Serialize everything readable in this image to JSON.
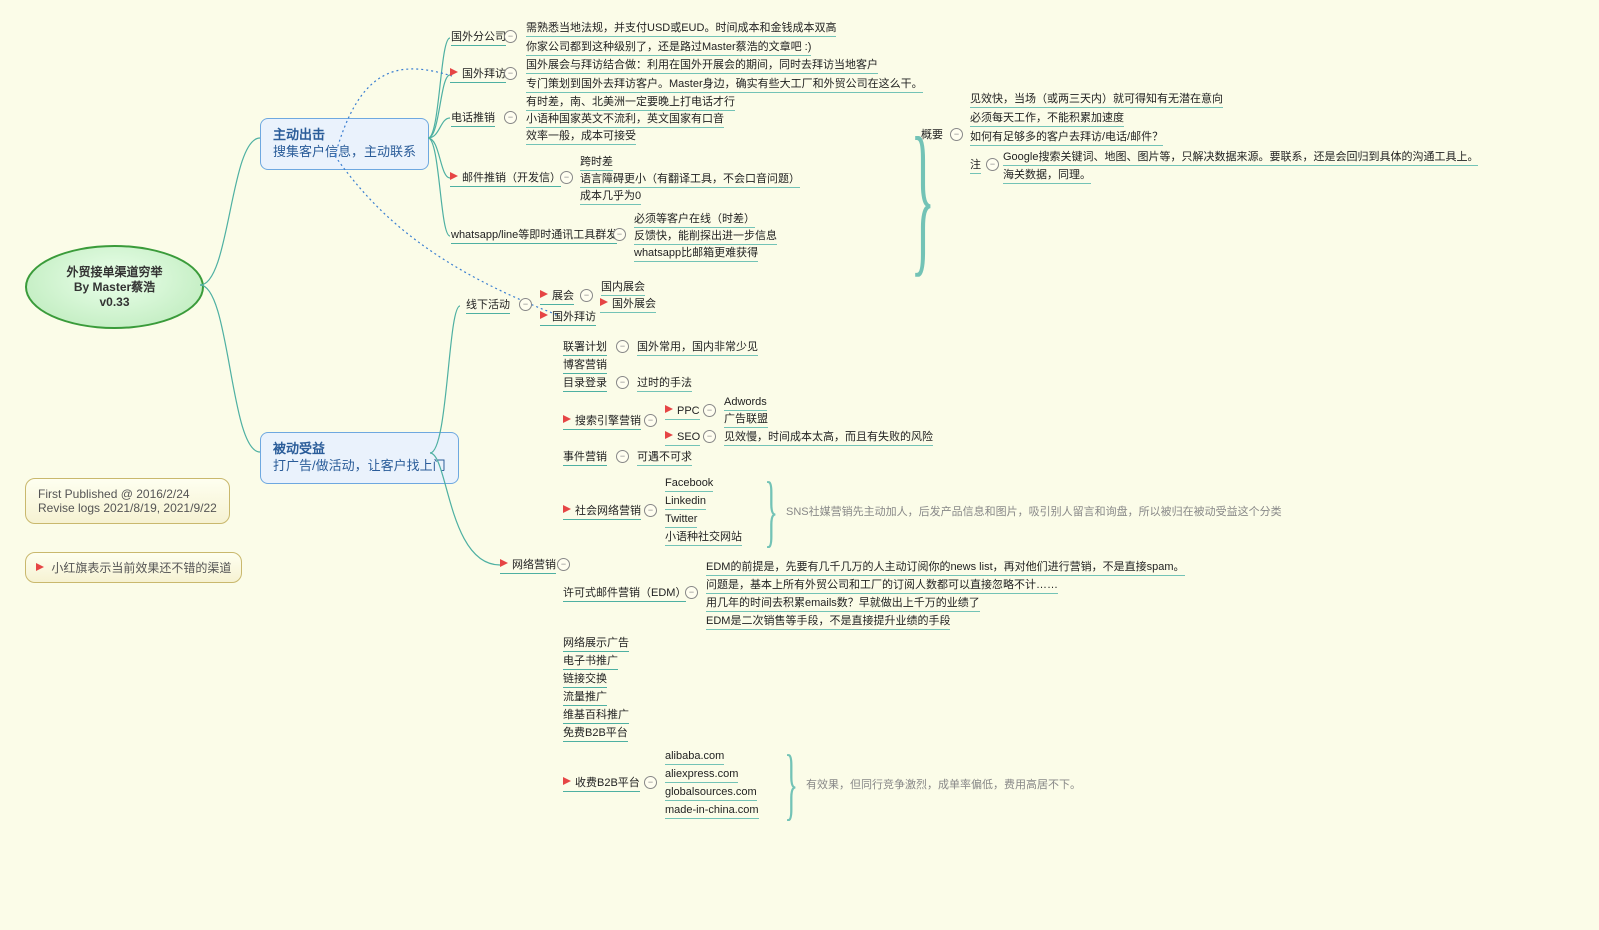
{
  "root": {
    "line1": "外贸接单渠道穷举",
    "line2": "By Master蔡浩",
    "line3": "v0.33"
  },
  "info": {
    "l1": "First Published @ 2016/2/24",
    "l2": "Revise logs 2021/8/19, 2021/9/22"
  },
  "legend": "小红旗表示当前效果还不错的渠道",
  "branch1": {
    "title": "主动出击",
    "sub": "搜集客户信息，主动联系"
  },
  "branch2": {
    "title": "被动受益",
    "sub": "打广告/做活动，让客户找上门"
  },
  "b1": {
    "c1": "国外分公司",
    "c1a": "需熟悉当地法规，并支付USD或EUD。时间成本和金钱成本双高",
    "c1b": "你家公司都到这种级别了，还是路过Master蔡浩的文章吧 :)",
    "c2": "国外拜访",
    "c2a": "国外展会与拜访结合做：利用在国外开展会的期间，同时去拜访当地客户",
    "c2b": "专门策划到国外去拜访客户。Master身边，确实有些大工厂和外贸公司在这么干。",
    "c3": "电话推销",
    "c3a": "有时差，南、北美洲一定要晚上打电话才行",
    "c3b": "小语种国家英文不流利，英文国家有口音",
    "c3c": "效率一般，成本可接受",
    "c4": "邮件推销（开发信）",
    "c4a": "跨时差",
    "c4b": "语言障碍更小（有翻译工具，不会口音问题）",
    "c4c": "成本几乎为0",
    "c5": "whatsapp/line等即时通讯工具群发",
    "c5a": "必须等客户在线（时差）",
    "c5b": "反馈快，能削探出进一步信息",
    "c5c": "whatsapp比邮箱更难获得"
  },
  "gy": {
    "title": "概要",
    "a": "见效快，当场（或两三天内）就可得知有无潜在意向",
    "b": "必须每天工作，不能积累加速度",
    "c": "如何有足够多的客户去拜访/电话/邮件？",
    "d": "注",
    "d1": "Google搜索关键词、地图、图片等，只解决数据来源。要联系，还是会回归到具体的沟通工具上。",
    "d2": "海关数据，同理。"
  },
  "b2": {
    "m1": "线下活动",
    "m1a": "展会",
    "m1a1": "国内展会",
    "m1a2": "国外展会",
    "m1b": "国外拜访",
    "m2": "网络营销",
    "m2a": "联署计划",
    "m2a_n": "国外常用，国内非常少见",
    "m2b": "博客营销",
    "m2c": "目录登录",
    "m2c_n": "过时的手法",
    "m2d": "搜索引擎营销",
    "m2d1": "PPC",
    "m2d1a": "Adwords",
    "m2d1b": "广告联盟",
    "m2d2": "SEO",
    "m2d2_n": "见效慢，时间成本太高，而且有失败的风险",
    "m2e": "事件营销",
    "m2e_n": "可遇不可求",
    "m2f": "社会网络营销",
    "m2f1": "Facebook",
    "m2f2": "Linkedin",
    "m2f3": "Twitter",
    "m2f4": "小语种社交网站",
    "m2f_note": "SNS社媒营销先主动加人，后发产品信息和图片，吸引别人留言和询盘，所以被归在被动受益这个分类",
    "m2g": "许可式邮件营销（EDM）",
    "m2g1": "EDM的前提是，先要有几千几万的人主动订阅你的news list，再对他们进行营销，不是直接spam。",
    "m2g2": "问题是，基本上所有外贸公司和工厂的订阅人数都可以直接忽略不计……",
    "m2g3": "用几年的时间去积累emails数？早就做出上千万的业绩了",
    "m2g4": "EDM是二次销售等手段，不是直接提升业绩的手段",
    "m2h": "网络展示广告",
    "m2i": "电子书推广",
    "m2j": "链接交换",
    "m2k": "流量推广",
    "m2l": "维基百科推广",
    "m2m": "免费B2B平台",
    "m2n": "收费B2B平台",
    "m2n1": "alibaba.com",
    "m2n2": "aliexpress.com",
    "m2n3": "globalsources.com",
    "m2n4": "made-in-china.com",
    "m2n_note": "有效果，但同行竞争激烈，成单率偏低，费用高居不下。"
  }
}
